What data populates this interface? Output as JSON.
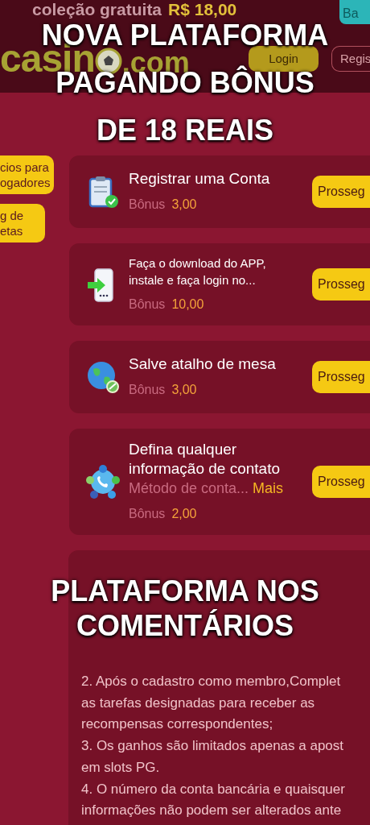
{
  "top_strip": {
    "text": "coleção gratuita",
    "amount": "R$ 18,00",
    "button": "Ba"
  },
  "header": {
    "logo_text": "casin",
    "logo_suffix": ".com",
    "login": "Login",
    "register": "Regis"
  },
  "sidebar": {
    "items": [
      {
        "lines": [
          "cios para",
          "ogadores"
        ]
      },
      {
        "lines": [
          "g de",
          "etas"
        ]
      }
    ]
  },
  "tasks": [
    {
      "title": "Registrar uma Conta",
      "bonus_label": "Bônus",
      "bonus": "3,00",
      "button": "Prosseg"
    },
    {
      "title": "Faça o download do APP, instale e faça login no...",
      "bonus_label": "Bônus",
      "bonus": "10,00",
      "button": "Prosseg"
    },
    {
      "title": "Salve atalho de mesa",
      "bonus_label": "Bônus",
      "bonus": "3,00",
      "button": "Prosseg"
    },
    {
      "title": "Defina qualquer informação de contato",
      "description": "Método de conta...",
      "more": "Mais",
      "bonus_label": "Bônus",
      "bonus": "2,00",
      "button": "Prosseg"
    }
  ],
  "details": {
    "lines": [
      "2. Após o cadastro como membro,Complet",
      "as tarefas designadas para receber as",
      "recompensas correspondentes;",
      "3. Os ganhos são limitados apenas a apost",
      "em slots PG.",
      "4. O número da conta bancária e quaisquer",
      "informações não podem ser alterados ante"
    ]
  },
  "captions": [
    {
      "lines": [
        "NOVA PLATAFORMA",
        "PAGANDO BÔNUS",
        "DE 18 REAIS"
      ]
    },
    {
      "lines": [
        "PLATAFORMA NOS",
        "COMENTÁRIOS"
      ]
    }
  ]
}
